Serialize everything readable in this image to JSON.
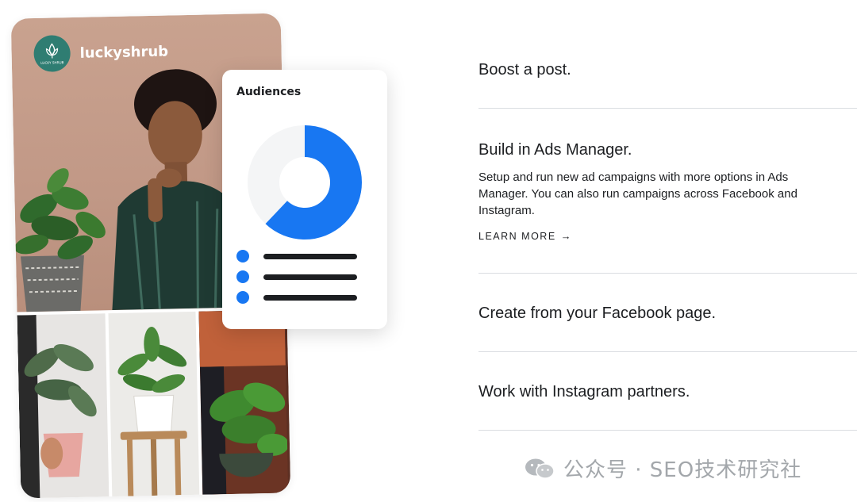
{
  "illustration": {
    "brand_name": "luckyshrub",
    "logo_text": "LUCKY SHRUB",
    "audiences_title": "Audiences",
    "donut_segment_fraction": 0.62,
    "colors": {
      "accent": "#1877f2",
      "brand_teal": "#2f7d72",
      "hero_bg": "#c49c8a"
    },
    "legend_items": 3
  },
  "options": [
    {
      "title": "Boost a post."
    },
    {
      "title": "Build in Ads Manager.",
      "description": "Setup and run new ad campaigns with more options in Ads Manager. You can also run campaigns across Facebook and Instagram.",
      "link_label": "LEARN MORE",
      "link_icon": "arrow-right-icon"
    },
    {
      "title": "Create from your Facebook page."
    },
    {
      "title": "Work with Instagram partners."
    }
  ],
  "watermark": {
    "text": "公众号 · SEO技术研究社",
    "icon": "wechat-icon"
  }
}
